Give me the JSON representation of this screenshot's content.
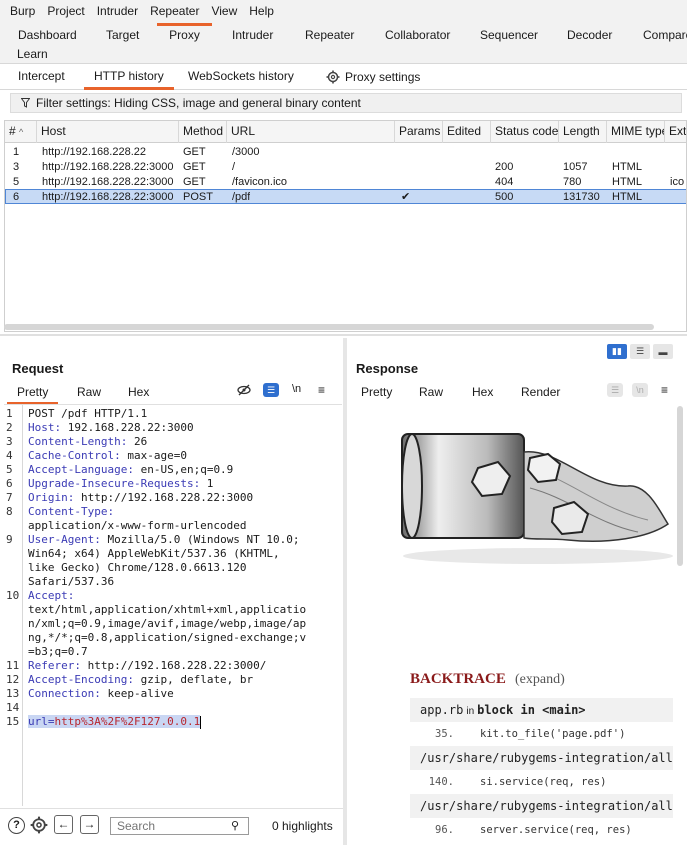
{
  "menu": [
    "Burp",
    "Project",
    "Intruder",
    "Repeater",
    "View",
    "Help"
  ],
  "main_tabs": [
    "Dashboard",
    "Target",
    "Proxy",
    "Intruder",
    "Repeater",
    "Collaborator",
    "Sequencer",
    "Decoder",
    "Compare",
    "Learn"
  ],
  "proxy_tabs": [
    "Intercept",
    "HTTP history",
    "WebSockets history",
    "Proxy settings"
  ],
  "filter_text": "Filter settings: Hiding CSS, image and general binary content",
  "table": {
    "headers": [
      "#",
      "Host",
      "Method",
      "URL",
      "Params",
      "Edited",
      "Status code",
      "Length",
      "MIME type",
      "Exte"
    ],
    "rows": [
      {
        "num": "1",
        "host": "http://192.168.228.22",
        "method": "GET",
        "url": "/3000",
        "params": "",
        "status": "",
        "length": "",
        "mime": "",
        "ext": ""
      },
      {
        "num": "3",
        "host": "http://192.168.228.22:3000",
        "method": "GET",
        "url": "/",
        "params": "",
        "status": "200",
        "length": "1057",
        "mime": "HTML",
        "ext": ""
      },
      {
        "num": "5",
        "host": "http://192.168.228.22:3000",
        "method": "GET",
        "url": "/favicon.ico",
        "params": "",
        "status": "404",
        "length": "780",
        "mime": "HTML",
        "ext": "ico"
      },
      {
        "num": "6",
        "host": "http://192.168.228.22:3000",
        "method": "POST",
        "url": "/pdf",
        "params": "✔",
        "status": "500",
        "length": "131730",
        "mime": "HTML",
        "ext": ""
      }
    ]
  },
  "request": {
    "title": "Request",
    "tabs": [
      "Pretty",
      "Raw",
      "Hex"
    ],
    "newline_label": "\\n",
    "lines": [
      {
        "n": "1",
        "text": "POST /pdf HTTP/1.1"
      },
      {
        "n": "2",
        "key": "Host:",
        "text": " 192.168.228.22:3000"
      },
      {
        "n": "3",
        "key": "Content-Length:",
        "text": " 26"
      },
      {
        "n": "4",
        "key": "Cache-Control:",
        "text": " max-age=0"
      },
      {
        "n": "5",
        "key": "Accept-Language:",
        "text": " en-US,en;q=0.9"
      },
      {
        "n": "6",
        "key": "Upgrade-Insecure-Requests:",
        "text": " 1"
      },
      {
        "n": "7",
        "key": "Origin:",
        "text": " http://192.168.228.22:3000"
      },
      {
        "n": "8",
        "key": "Content-Type:",
        "text": ""
      },
      {
        "n": "",
        "text": "application/x-www-form-urlencoded"
      },
      {
        "n": "9",
        "key": "User-Agent:",
        "text": " Mozilla/5.0 (Windows NT 10.0;"
      },
      {
        "n": "",
        "text": "Win64; x64) AppleWebKit/537.36 (KHTML,"
      },
      {
        "n": "",
        "text": "like Gecko) Chrome/128.0.6613.120"
      },
      {
        "n": "",
        "text": "Safari/537.36"
      },
      {
        "n": "10",
        "key": "Accept:",
        "text": ""
      },
      {
        "n": "",
        "text": "text/html,application/xhtml+xml,applicatio"
      },
      {
        "n": "",
        "text": "n/xml;q=0.9,image/avif,image/webp,image/ap"
      },
      {
        "n": "",
        "text": "ng,*/*;q=0.8,application/signed-exchange;v"
      },
      {
        "n": "",
        "text": "=b3;q=0.7"
      },
      {
        "n": "11",
        "key": "Referer:",
        "text": " http://192.168.228.22:3000/"
      },
      {
        "n": "12",
        "key": "Accept-Encoding:",
        "text": " gzip, deflate, br"
      },
      {
        "n": "13",
        "key": "Connection:",
        "text": " keep-alive"
      },
      {
        "n": "14",
        "text": ""
      },
      {
        "n": "15",
        "body_key": "url=",
        "body_val": "http%3A%2F%2F127.0.0.1"
      }
    ]
  },
  "bottom": {
    "search_placeholder": "Search",
    "highlights": "0 highlights"
  },
  "response": {
    "title": "Response",
    "tabs": [
      "Pretty",
      "Raw",
      "Hex",
      "Render"
    ],
    "newline_label": "\\n",
    "backtrace_title": "BACKTRACE",
    "backtrace_expand": "(expand)",
    "backtrace": [
      {
        "type": "head",
        "file": "app.rb",
        "in": "in",
        "block": "block in <main>"
      },
      {
        "type": "line",
        "num": "35.",
        "src": "kit.to_file('page.pdf')"
      },
      {
        "type": "head",
        "file": "/usr/share/rubygems-integration/all",
        "in": "",
        "block": ""
      },
      {
        "type": "line",
        "num": "140.",
        "src": "si.service(req, res)"
      },
      {
        "type": "head",
        "file": "/usr/share/rubygems-integration/all",
        "in": "",
        "block": ""
      },
      {
        "type": "line",
        "num": "96.",
        "src": "server.service(req, res)"
      }
    ]
  }
}
